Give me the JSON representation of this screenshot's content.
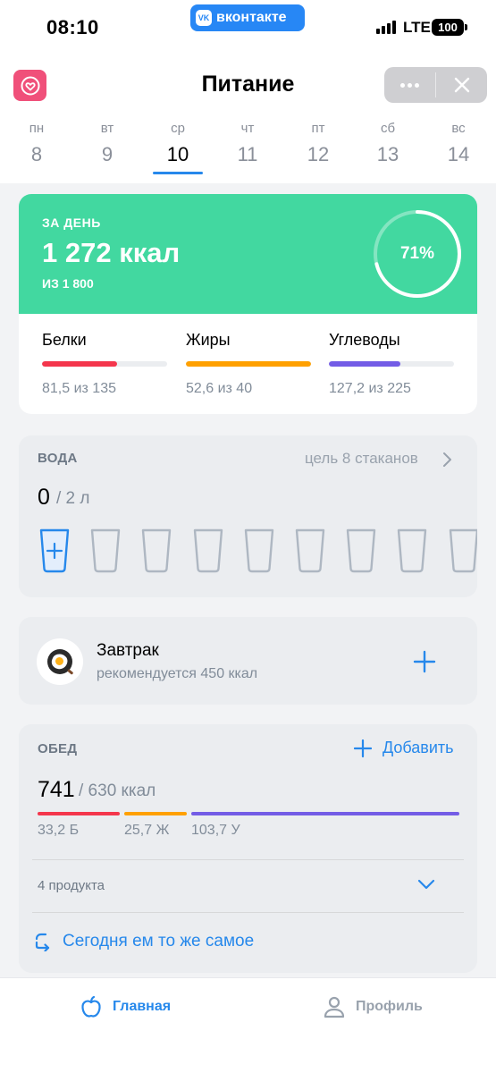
{
  "status_bar": {
    "time": "08:10",
    "vk_label": "вконтакте",
    "network": "LTE",
    "battery": "100"
  },
  "header": {
    "title": "Питание"
  },
  "week": [
    {
      "name": "пн",
      "num": "8"
    },
    {
      "name": "вт",
      "num": "9"
    },
    {
      "name": "ср",
      "num": "10",
      "active": true
    },
    {
      "name": "чт",
      "num": "11"
    },
    {
      "name": "пт",
      "num": "12"
    },
    {
      "name": "сб",
      "num": "13"
    },
    {
      "name": "вс",
      "num": "14"
    }
  ],
  "summary": {
    "label": "ЗА ДЕНЬ",
    "kcal": "1 272 ккал",
    "of": "ИЗ 1 800",
    "percent": "71%",
    "progress": 0.71,
    "macros": [
      {
        "name": "Белки",
        "value": "81,5 из 135",
        "fraction": 0.6,
        "color": "#f4364c"
      },
      {
        "name": "Жиры",
        "value": "52,6 из 40",
        "fraction": 1.0,
        "color": "#ffa000"
      },
      {
        "name": "Углеводы",
        "value": "127,2 из 225",
        "fraction": 0.57,
        "color": "#735ce6"
      }
    ]
  },
  "water": {
    "title": "ВОДА",
    "goal": "цель 8 стаканов",
    "count": "0",
    "of": "/ 2 л",
    "glasses": 9
  },
  "breakfast": {
    "name": "Завтрак",
    "recommend": "рекомендуется 450 ккал"
  },
  "lunch": {
    "title": "ОБЕД",
    "add_label": "Добавить",
    "kcal": "741",
    "of": "/ 630 ккал",
    "macros": [
      {
        "value": "33,2 Б",
        "color": "#f4364c"
      },
      {
        "value": "25,7 Ж",
        "color": "#ffa000"
      },
      {
        "value": "103,7 У",
        "color": "#735ce6"
      }
    ],
    "products": "4 продукта",
    "same_label": "Сегодня ем то же самое"
  },
  "tabs": {
    "home": "Главная",
    "profile": "Профиль"
  },
  "colors": {
    "accent": "#2688eb",
    "summary_green": "#42d8a0",
    "brand_pink": "#f0507a"
  }
}
